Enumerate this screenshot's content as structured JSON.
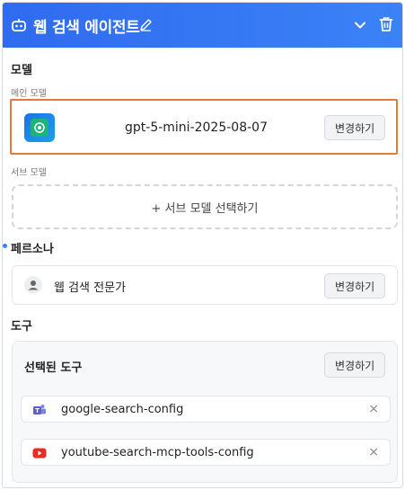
{
  "header": {
    "title": "웹 검색 에이전트"
  },
  "model_section": {
    "title": "모델",
    "main_label": "메인 모델",
    "main_model_name": "gpt-5-mini-2025-08-07",
    "change_label": "변경하기",
    "sub_label": "서브 모델",
    "sub_select_label": "+ 서브 모델 선택하기"
  },
  "persona_section": {
    "title": "페르소나",
    "persona_name": "웹 검색 전문가",
    "change_label": "변경하기"
  },
  "tools_section": {
    "title": "도구",
    "selected_title": "선택된 도구",
    "change_label": "변경하기",
    "tools": [
      {
        "name": "google-search-config",
        "icon": "teams-icon",
        "remove": "×"
      },
      {
        "name": "youtube-search-mcp-tools-config",
        "icon": "youtube-icon",
        "remove": "×"
      }
    ]
  },
  "colors": {
    "header": "#3b82f6",
    "highlight_border": "#e07a3e",
    "youtube": "#e52d27",
    "teams": "#5b5fc7"
  }
}
